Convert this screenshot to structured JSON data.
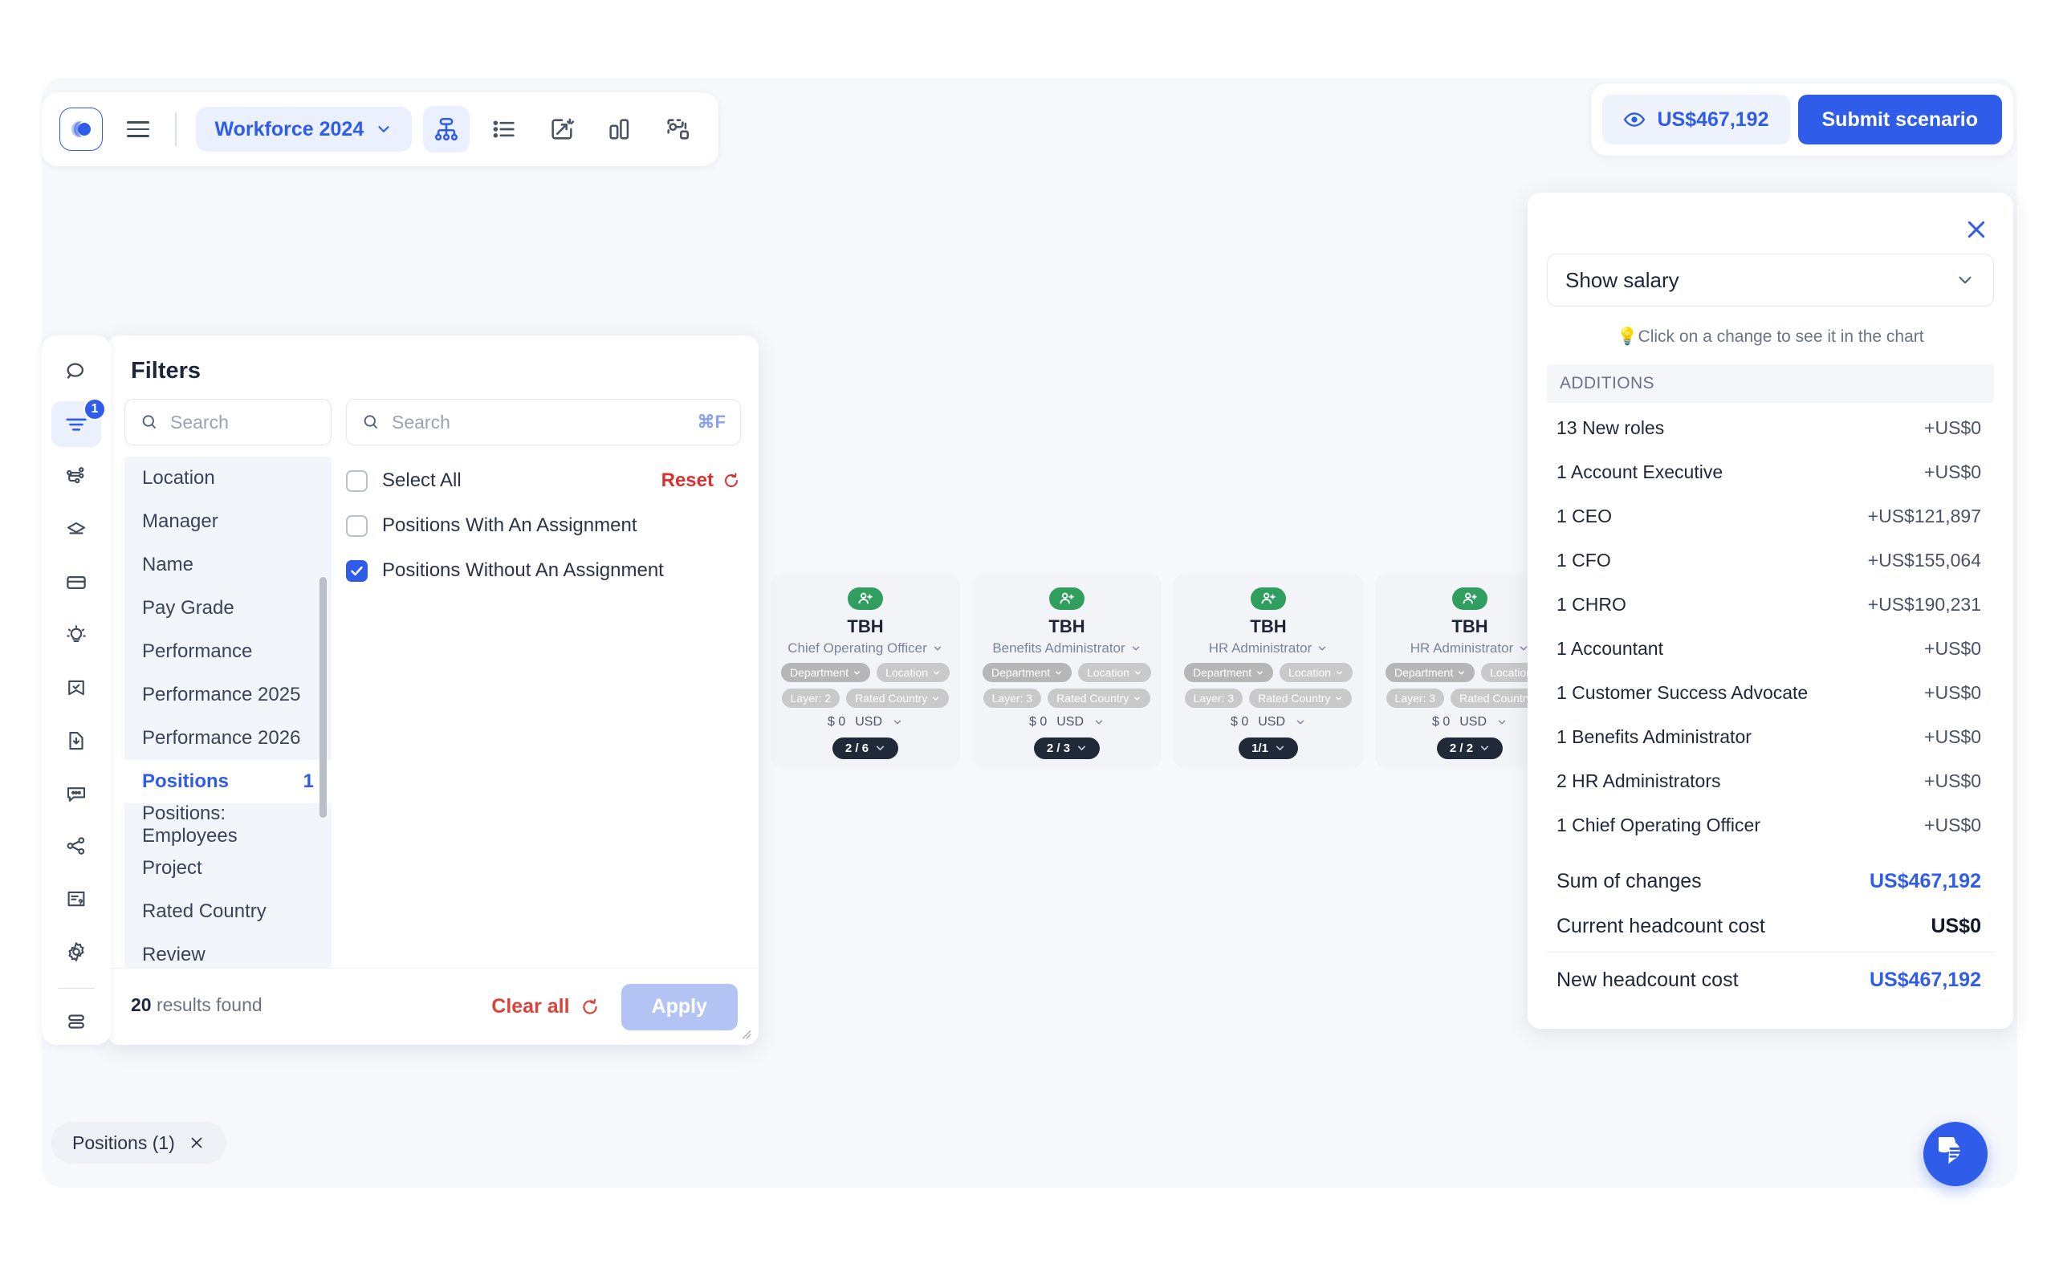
{
  "toolbar": {
    "logo_icon": "company-logo-icon",
    "menu_icon": "hamburger-menu-icon",
    "scenario_label": "Workforce 2024",
    "scenario_chevron_icon": "chevron-down-icon",
    "view_buttons": [
      {
        "name": "org-chart-view",
        "icon": "org-chart-icon",
        "active": true
      },
      {
        "name": "list-view",
        "icon": "list-icon",
        "active": false
      },
      {
        "name": "insights-view",
        "icon": "magic-wand-icon",
        "active": false
      },
      {
        "name": "analytics-view",
        "icon": "bar-chart-icon",
        "active": false
      },
      {
        "name": "network-view",
        "icon": "network-nodes-icon",
        "active": false
      }
    ]
  },
  "header": {
    "cost_icon": "eye-icon",
    "cost_value": "US$467,192",
    "submit_label": "Submit scenario"
  },
  "rail": {
    "items": [
      {
        "name": "search",
        "icon": "search-icon",
        "active": false,
        "badge": ""
      },
      {
        "name": "filters",
        "icon": "filter-icon",
        "active": true,
        "badge": "1"
      },
      {
        "name": "hierarchy",
        "icon": "hierarchy-icon",
        "active": false,
        "badge": ""
      },
      {
        "name": "layers",
        "icon": "layers-icon",
        "active": false,
        "badge": ""
      },
      {
        "name": "cards",
        "icon": "card-stack-icon",
        "active": false,
        "badge": ""
      },
      {
        "name": "insights",
        "icon": "lightbulb-icon",
        "active": false,
        "badge": ""
      },
      {
        "name": "bookmarks",
        "icon": "bookmark-check-icon",
        "active": false,
        "badge": ""
      },
      {
        "name": "export",
        "icon": "file-download-icon",
        "active": false,
        "badge": ""
      },
      {
        "name": "comments",
        "icon": "comment-icon",
        "active": false,
        "badge": ""
      },
      {
        "name": "share",
        "icon": "share-icon",
        "active": false,
        "badge": ""
      },
      {
        "name": "help",
        "icon": "document-question-icon",
        "active": false,
        "badge": ""
      },
      {
        "name": "settings",
        "icon": "gear-icon",
        "active": false,
        "badge": ""
      },
      {
        "name": "stack",
        "icon": "stack-icon",
        "active": false,
        "badge": ""
      }
    ]
  },
  "filters": {
    "title": "Filters",
    "category_search_placeholder": "Search",
    "option_search_placeholder": "Search",
    "kbd_hint": "⌘F",
    "categories": [
      {
        "label": "Location",
        "count": "",
        "selected": false
      },
      {
        "label": "Manager",
        "count": "",
        "selected": false
      },
      {
        "label": "Name",
        "count": "",
        "selected": false
      },
      {
        "label": "Pay Grade",
        "count": "",
        "selected": false
      },
      {
        "label": "Performance",
        "count": "",
        "selected": false
      },
      {
        "label": "Performance 2025",
        "count": "",
        "selected": false
      },
      {
        "label": "Performance 2026",
        "count": "",
        "selected": false
      },
      {
        "label": "Positions",
        "count": "1",
        "selected": true
      },
      {
        "label": "Positions: Employees",
        "count": "",
        "selected": false
      },
      {
        "label": "Project",
        "count": "",
        "selected": false
      },
      {
        "label": "Rated Country",
        "count": "",
        "selected": false
      },
      {
        "label": "Review",
        "count": "",
        "selected": false
      }
    ],
    "options": [
      {
        "label": "Select All",
        "checked": false
      },
      {
        "label": "Positions With An Assignment",
        "checked": false
      },
      {
        "label": "Positions Without An Assignment",
        "checked": true
      }
    ],
    "reset_label": "Reset",
    "results_count": "20",
    "results_suffix": " results found",
    "clear_all_label": "Clear all",
    "apply_label": "Apply"
  },
  "chart": {
    "cards": [
      {
        "name": "TBH",
        "role": "Chief Operating Officer",
        "department_tag": "Department",
        "location_tag": "Location",
        "layer_tag": "Layer: 2",
        "country_tag": "Rated Country",
        "salary": "$ 0",
        "currency": "USD",
        "count": "2 / 6"
      },
      {
        "name": "TBH",
        "role": "Benefits Administrator",
        "department_tag": "Department",
        "location_tag": "Location",
        "layer_tag": "Layer: 3",
        "country_tag": "Rated Country",
        "salary": "$ 0",
        "currency": "USD",
        "count": "2 / 3"
      },
      {
        "name": "TBH",
        "role": "HR Administrator",
        "department_tag": "Department",
        "location_tag": "Location",
        "layer_tag": "Layer: 3",
        "country_tag": "Rated Country",
        "salary": "$ 0",
        "currency": "USD",
        "count": "1/1"
      },
      {
        "name": "TBH",
        "role": "HR Administrator",
        "department_tag": "Department",
        "location_tag": "Location",
        "layer_tag": "Layer: 3",
        "country_tag": "Rated Country",
        "salary": "$ 0",
        "currency": "USD",
        "count": "2 / 2"
      }
    ]
  },
  "right_panel": {
    "close_icon": "close-icon",
    "select_value": "Show salary",
    "select_chevron_icon": "chevron-down-icon",
    "hint": "💡Click on a change to see it in the chart",
    "section_title": "ADDITIONS",
    "changes": [
      {
        "label": "13 New roles",
        "amount": "+US$0"
      },
      {
        "label": "1 Account Executive",
        "amount": "+US$0"
      },
      {
        "label": "1 CEO",
        "amount": "+US$121,897"
      },
      {
        "label": "1 CFO",
        "amount": "+US$155,064"
      },
      {
        "label": "1 CHRO",
        "amount": "+US$190,231"
      },
      {
        "label": "1 Accountant",
        "amount": "+US$0"
      },
      {
        "label": "1 Customer Success Advocate",
        "amount": "+US$0"
      },
      {
        "label": "1 Benefits Administrator",
        "amount": "+US$0"
      },
      {
        "label": "2 HR Administrators",
        "amount": "+US$0"
      },
      {
        "label": "1 Chief Operating Officer",
        "amount": "+US$0"
      }
    ],
    "sum_label": "Sum of changes",
    "sum_value": "US$467,192",
    "current_label": "Current headcount cost",
    "current_value": "US$0",
    "new_label": "New headcount cost",
    "new_value": "US$467,192"
  },
  "status_bar": {
    "chip_label": "Positions (1)",
    "chip_close_icon": "close-icon"
  },
  "chat": {
    "icon": "chat-bubble-icon"
  },
  "colors": {
    "accent": "#2f5ce8",
    "danger": "#d9453c",
    "green": "#2f9e5e",
    "canvas": "#f6f8fb"
  }
}
